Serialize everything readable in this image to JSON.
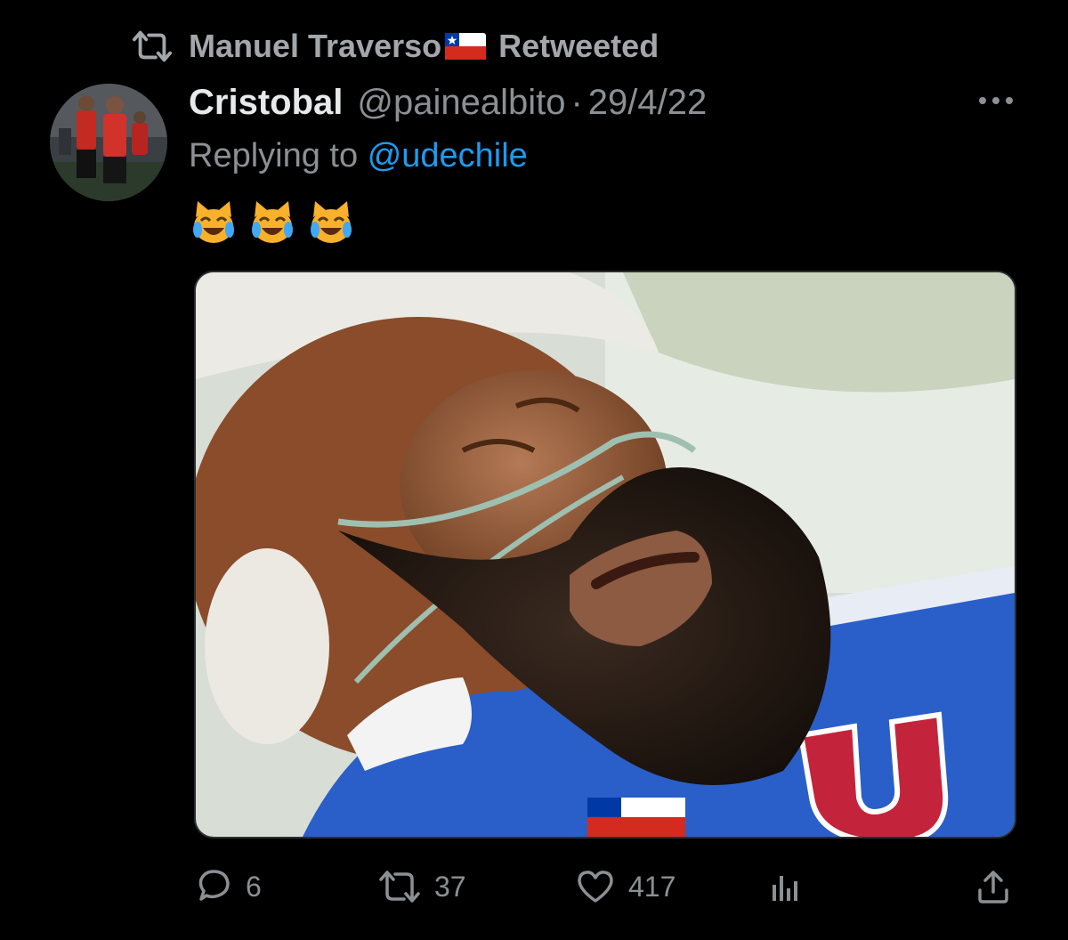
{
  "retweet_bar": {
    "retweeter": "Manuel Traverso",
    "flag_icon": "chile-flag-icon",
    "label": "Retweeted"
  },
  "tweet": {
    "display_name": "Cristobal",
    "handle": "@painealbito",
    "separator": "·",
    "date": "29/4/22",
    "reply_prefix": "Replying to",
    "reply_to": "@udechile",
    "emojis": [
      "cat-tears-of-joy",
      "cat-tears-of-joy",
      "cat-tears-of-joy"
    ]
  },
  "actions": {
    "reply_count": "6",
    "retweet_count": "37",
    "like_count": "417"
  },
  "colors": {
    "background": "#000000",
    "primary_text": "#e7e9ea",
    "secondary_text": "#8b9095",
    "link": "#1d9bf0"
  }
}
